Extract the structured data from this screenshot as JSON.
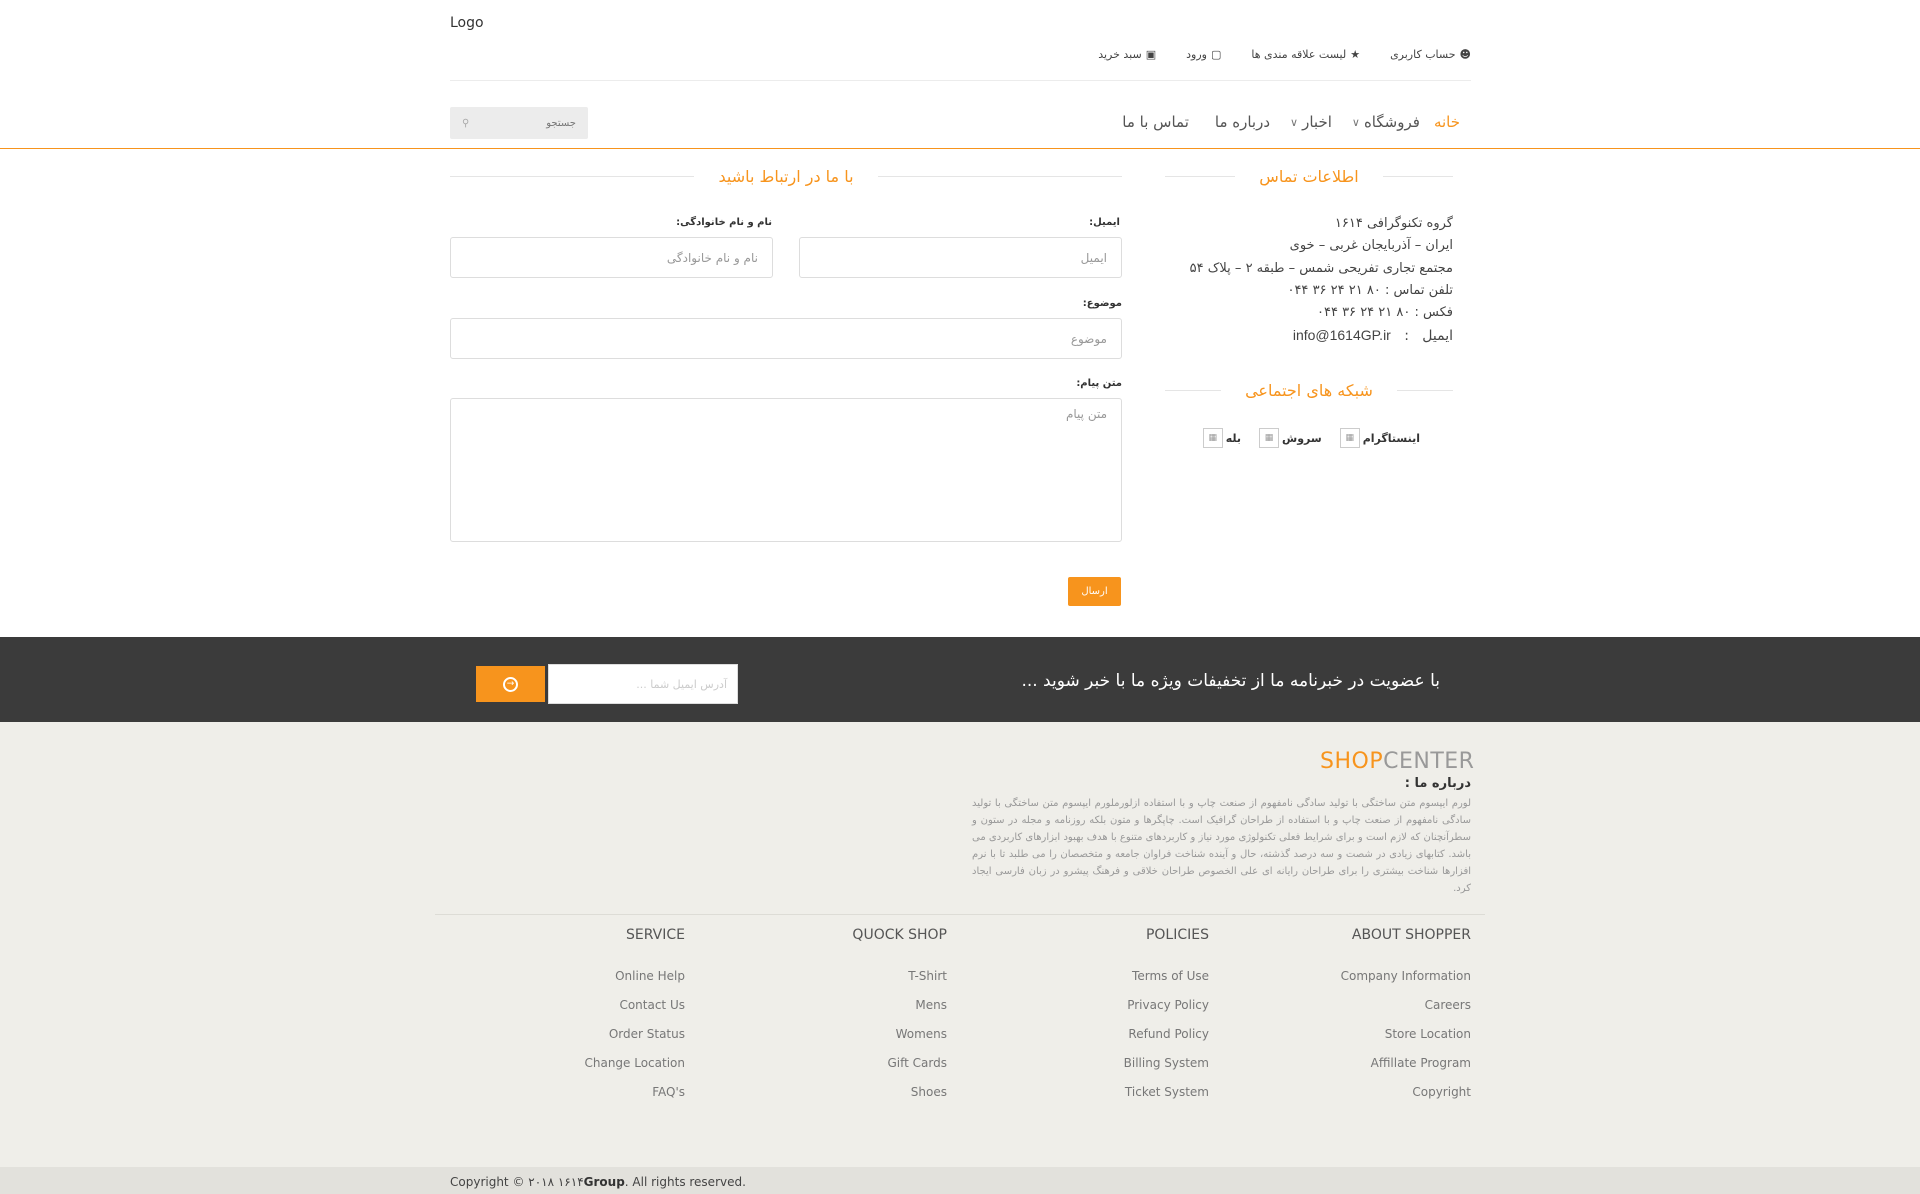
{
  "header": {
    "logo": "Logo",
    "top_links": [
      {
        "icon": "user-icon",
        "glyph": "👤",
        "label": "حساب کاربری"
      },
      {
        "icon": "star-icon",
        "glyph": "★",
        "label": "لیست علاقه مندی ها"
      },
      {
        "icon": "lock-icon",
        "glyph": "🔒",
        "label": "ورود"
      },
      {
        "icon": "cart-icon",
        "glyph": "🛒",
        "label": "سبد خرید"
      }
    ],
    "nav": [
      {
        "label": "خانه",
        "active": true,
        "dropdown": false
      },
      {
        "label": "فروشگاه",
        "active": false,
        "dropdown": true
      },
      {
        "label": "اخبار",
        "active": false,
        "dropdown": true
      },
      {
        "label": "درباره ما",
        "active": false,
        "dropdown": false
      },
      {
        "label": "تماس با ما",
        "active": false,
        "dropdown": false
      }
    ],
    "search_placeholder": "جستجو"
  },
  "contact": {
    "title": "اطلاعات تماس",
    "lines": [
      "گروه تکنوگرافی ۱۶۱۴",
      "ایران – آذربایجان غربی – خوی",
      "مجتمع تجاری تفریحی شمس – طبقه ۲ – پلاک ۵۴",
      "تلفن تماس : ۸۰ ۲۱ ۲۴ ۳۶ ۰۴۴",
      "فکس : ۸۰ ۲۱ ۲۴ ۳۶ ۰۴۴"
    ],
    "email_label": "ایمیل",
    "email": "info@1614GP.ir"
  },
  "social": {
    "title": "شبکه های اجتماعی",
    "items": [
      "اینستاگرام",
      "سروش",
      "بله"
    ]
  },
  "form": {
    "title": "با ما در ارتباط باشید",
    "email_label": "ایمیل:",
    "email_placeholder": "ایمیل",
    "name_label": "نام و نام خانوادگی:",
    "name_placeholder": "نام و نام خانوادگی",
    "subject_label": "موضوع:",
    "subject_placeholder": "موضوع",
    "message_label": "متن پیام:",
    "message_placeholder": "متن پیام",
    "submit": "ارسال"
  },
  "newsletter": {
    "text": "با عضویت در خبرنامه ما از تخفیفات ویژه ما با خبر شوید ...",
    "placeholder": "آدرس ایمیل شما ..."
  },
  "footer": {
    "brand_a": "SHOP",
    "brand_b": "CENTER",
    "about_title": "درباره ما :",
    "about_text": "لورم ایپسوم متن ساختگی با تولید سادگی نامفهوم از صنعت چاپ و با استفاده ازلورملورم ایپسوم متن ساختگی با تولید سادگی نامفهوم از صنعت چاپ و با استفاده از طراحان گرافیک است. چاپگرها و متون بلکه روزنامه و مجله در ستون و سطرآنچنان که لازم است و برای شرایط فعلی تکنولوژی مورد نیاز و کاربردهای متنوع با هدف بهبود ابزارهای کاربردی می باشد. کتابهای زیادی در شصت و سه درصد گذشته، حال و آینده شناخت فراوان جامعه و متخصصان را می طلبد تا با نرم افزارها شناخت بیشتری را برای طراحان رایانه ای علی الخصوص طراحان خلاقی و فرهنگ پیشرو در زبان فارسی ایجاد کرد.",
    "columns": [
      {
        "title": "ABOUT SHOPPER",
        "links": [
          "Company Information",
          "Careers",
          "Store Location",
          "Affillate Program",
          "Copyright"
        ]
      },
      {
        "title": "POLICIES",
        "links": [
          "Terms of Use",
          "Privacy Policy",
          "Refund Policy",
          "Billing System",
          "Ticket System"
        ]
      },
      {
        "title": "QUOCK SHOP",
        "links": [
          "T-Shirt",
          "Mens",
          "Womens",
          "Gift Cards",
          "Shoes"
        ]
      },
      {
        "title": "SERVICE",
        "links": [
          "Online Help",
          "Contact Us",
          "Order Status",
          "Change Location",
          "FAQ's"
        ]
      }
    ],
    "copyright_pre": "Copyright © ۲۰۱۸ ۱۶۱۴",
    "copyright_bold": "Group",
    "copyright_post": ". All rights reserved."
  },
  "colors": {
    "accent": "#f7941d",
    "newsletter_bg": "#3b3b3b",
    "footer_bg": "#efeee9"
  }
}
